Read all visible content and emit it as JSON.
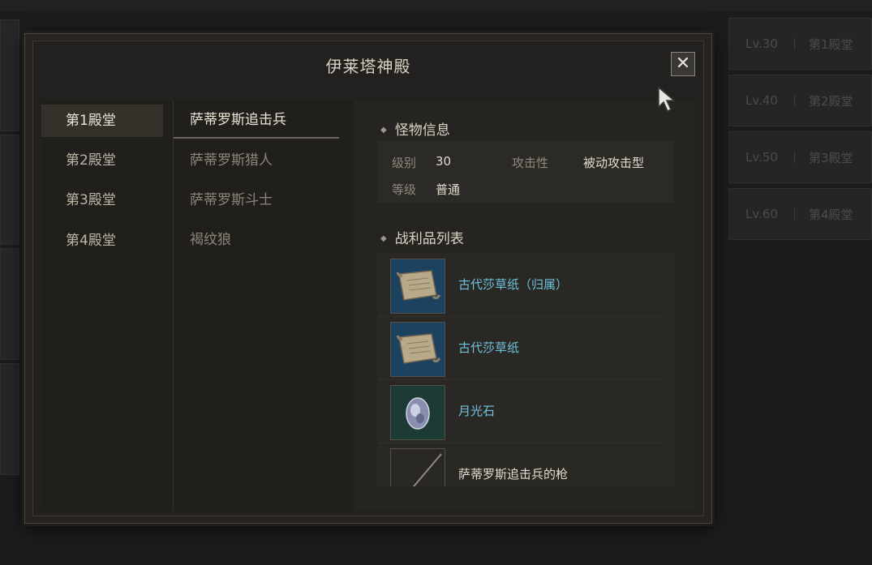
{
  "background": {
    "right_list": [
      {
        "level": "Lv.30",
        "hall": "第1殿堂"
      },
      {
        "level": "Lv.40",
        "hall": "第2殿堂"
      },
      {
        "level": "Lv.50",
        "hall": "第3殿堂"
      },
      {
        "level": "Lv.60",
        "hall": "第4殿堂"
      }
    ]
  },
  "modal": {
    "title": "伊莱塔神殿",
    "close_icon": "close-icon"
  },
  "halls": [
    {
      "label": "第1殿堂",
      "active": true
    },
    {
      "label": "第2殿堂",
      "active": false
    },
    {
      "label": "第3殿堂",
      "active": false
    },
    {
      "label": "第4殿堂",
      "active": false
    }
  ],
  "monsters": [
    {
      "label": "萨蒂罗斯追击兵",
      "active": true
    },
    {
      "label": "萨蒂罗斯猎人",
      "active": false
    },
    {
      "label": "萨蒂罗斯斗士",
      "active": false
    },
    {
      "label": "褐纹狼",
      "active": false
    }
  ],
  "monster_info": {
    "heading": "怪物信息",
    "level_label": "级别",
    "level_value": "30",
    "aggro_label": "攻击性",
    "aggro_value": "被动攻击型",
    "rank_label": "等级",
    "rank_value": "普通"
  },
  "loot": {
    "heading": "战利品列表",
    "items": [
      {
        "name": "古代莎草纸（归属）",
        "icon": "scroll-icon",
        "color": "#6fc3dc"
      },
      {
        "name": "古代莎草纸",
        "icon": "scroll-icon",
        "color": "#6fc3dc"
      },
      {
        "name": "月光石",
        "icon": "gem-icon",
        "color": "#6fc3dc"
      },
      {
        "name": "萨蒂罗斯追击兵的枪",
        "icon": "spear-icon",
        "color": "#e3dccd"
      }
    ]
  }
}
